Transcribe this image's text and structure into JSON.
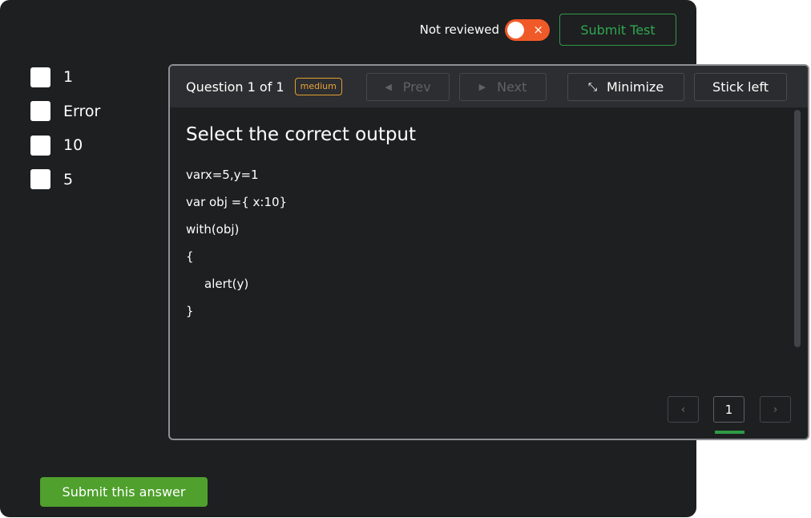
{
  "header": {
    "review_label": "Not reviewed",
    "toggle_icon": "×",
    "submit_test_label": "Submit Test"
  },
  "options": [
    "1",
    "Error",
    "10",
    "5"
  ],
  "submit_answer_label": "Submit this answer",
  "panel": {
    "question_count": "Question 1 of 1",
    "difficulty": "medium",
    "prev_label": "Prev",
    "next_label": "Next",
    "minimize_label": "Minimize",
    "stick_left_label": "Stick left",
    "question_title": "Select the correct output",
    "code_lines": [
      "varx=5,y=1",
      "var obj ={ x:10}",
      "with(obj)",
      "{",
      "alert(y)",
      "}"
    ],
    "pager": {
      "current_page": "1",
      "prev_icon": "‹",
      "next_icon": "›"
    }
  },
  "colors": {
    "background": "#1e1f21",
    "accent_green": "#2e9b46",
    "submit_green": "#4fa02d",
    "toggle_orange": "#f05a28",
    "badge_orange": "#e0a02c"
  }
}
